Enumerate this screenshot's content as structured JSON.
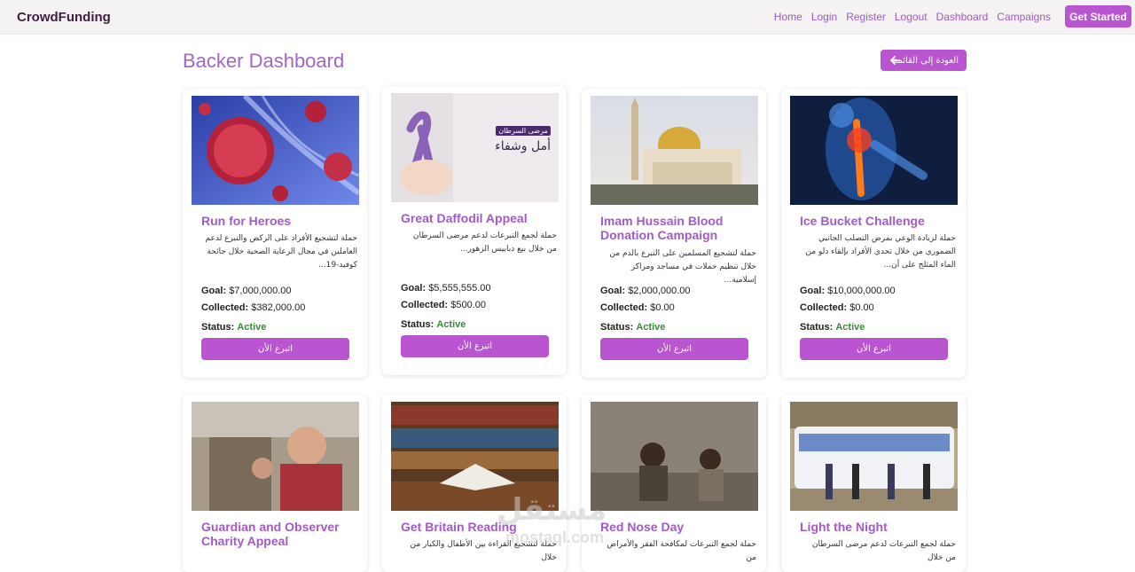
{
  "navbar": {
    "brand": "CrowdFunding",
    "links": [
      "Home",
      "Login",
      "Register",
      "Logout",
      "Dashboard",
      "Campaigns"
    ],
    "cta": "Get Started"
  },
  "page": {
    "title": "Backer Dashboard",
    "back_label": "العودة إلى القائمة"
  },
  "labels": {
    "goal": "Goal:",
    "collected": "Collected:",
    "status": "Status:",
    "donate": "اتبرع الأن"
  },
  "cards": [
    {
      "title": "Run for Heroes",
      "description": "حملة لتشجيع الأفراد على الركض والتبرع لدعم العاملين في مجال الرعاية الصحية خلال جائحة كوفيد-19...",
      "goal": "$7,000,000.00",
      "collected": "$382,000.00",
      "status": "Active",
      "image": "virus-dna-image"
    },
    {
      "title": "Great Daffodil Appeal",
      "description": "حملة لجمع التبرعات لدعم مرضى السرطان من خلال بيع دبابيس الزهور...",
      "goal": "$5,555,555.00",
      "collected": "$500.00",
      "status": "Active",
      "image": "ribbon-image",
      "image_text": [
        "مرضى السرطان",
        "أمل وشفاء"
      ]
    },
    {
      "title": "Imam Hussain Blood Donation Campaign",
      "description": "حملة لتشجيع المسلمين على التبرع بالدم من خلال تنظيم حملات في مساجد ومراكز إسلامية...",
      "goal": "$2,000,000.00",
      "collected": "$0.00",
      "status": "Active",
      "image": "mosque-image"
    },
    {
      "title": "Ice Bucket Challenge",
      "description": "حملة لزيادة الوعي بمرض التصلب الجانبي الضموري من خلال تحدي الأفراد بإلقاء دلو من الماء المثلج على أن...",
      "goal": "$10,000,000.00",
      "collected": "$0.00",
      "status": "Active",
      "image": "spine-image"
    },
    {
      "title": "Guardian and Observer Charity Appeal",
      "description": "",
      "image": "children-image"
    },
    {
      "title": "Get Britain Reading",
      "description": "حملة لتشجيع القراءة بين الأطفال والكبار من خلال",
      "image": "library-book-image"
    },
    {
      "title": "Red Nose Day",
      "description": "حملة لجمع التبرعات لمكافحة الفقر والأمراض من",
      "image": "poverty-children-image"
    },
    {
      "title": "Light the Night",
      "description": "حملة لجمع التبرعات لدعم مرضى السرطان من خلال",
      "image": "bus-group-image"
    }
  ],
  "watermark": {
    "arabic": "مستقل",
    "latin": "mostaql.com"
  },
  "colors": {
    "accent": "#b955d0",
    "title": "#a166c6",
    "active": "#3c8a3a"
  }
}
